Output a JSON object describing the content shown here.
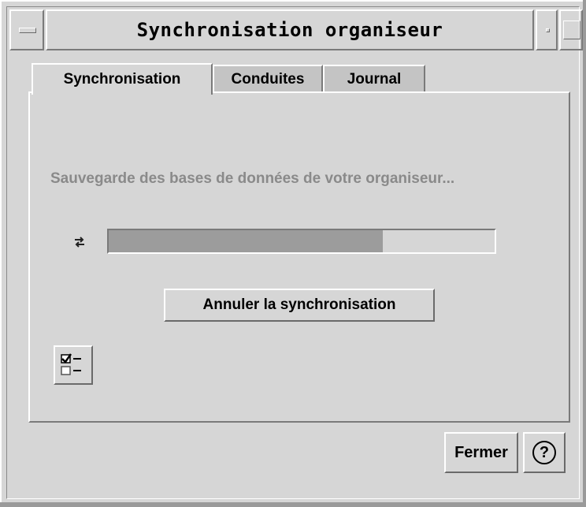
{
  "window": {
    "title": "Synchronisation organiseur"
  },
  "tabs": [
    {
      "label": "Synchronisation",
      "active": true
    },
    {
      "label": "Conduites",
      "active": false
    },
    {
      "label": "Journal",
      "active": false
    }
  ],
  "panel": {
    "status_text": "Sauvegarde des bases de données de votre organiseur...",
    "progress_fraction": 0.71,
    "cancel_label": "Annuler la synchronisation",
    "sync_icon": "sync-arrows-icon",
    "checklist_icon": "checklist-icon"
  },
  "footer": {
    "close_label": "Fermer",
    "help_glyph": "?"
  },
  "colors": {
    "background": "#d6d6d6",
    "progress_fill": "#9c9c9c",
    "disabled_text": "#8a8a8a"
  }
}
